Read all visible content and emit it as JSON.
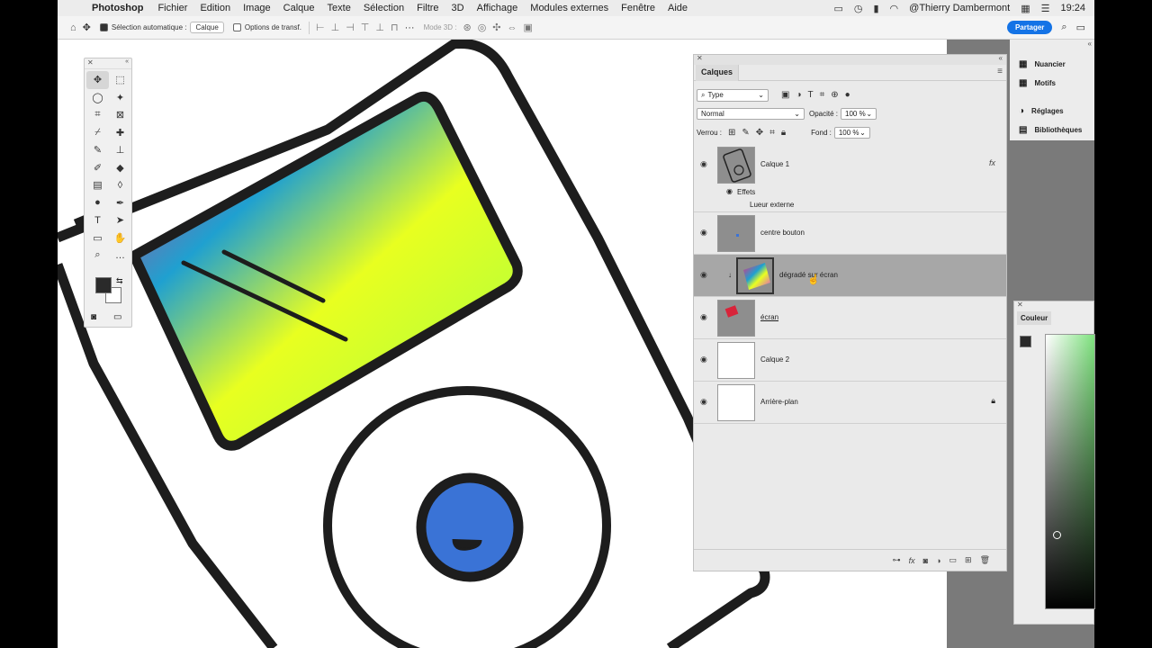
{
  "menubar": {
    "app": "Photoshop",
    "items": [
      "Fichier",
      "Edition",
      "Image",
      "Calque",
      "Texte",
      "Sélection",
      "Filtre",
      "3D",
      "Affichage",
      "Modules externes",
      "Fenêtre",
      "Aide"
    ],
    "user": "@Thierry Dambermont",
    "time": "19:24"
  },
  "optbar": {
    "auto_select_label": "Sélection automatique :",
    "auto_select_value": "Calque",
    "transform_label": "Options de transf.",
    "mode3d": "Mode 3D :",
    "share": "Partager"
  },
  "layers_panel": {
    "tab": "Calques",
    "filter": "Type",
    "blend_mode": "Normal",
    "opacity_label": "Opacité :",
    "opacity": "100 %",
    "lock_label": "Verrou :",
    "fill_label": "Fond :",
    "fill": "100 %",
    "layers": [
      {
        "name": "Calque 1",
        "fx": "fx",
        "effects_label": "Effets",
        "effect": "Lueur externe"
      },
      {
        "name": "centre bouton"
      },
      {
        "name": "dégradé sur écran"
      },
      {
        "name": "écran"
      },
      {
        "name": "Calque 2"
      },
      {
        "name": "Arrière-plan"
      }
    ]
  },
  "dock": {
    "items": [
      "Nuancier",
      "Motifs",
      "Réglages",
      "Bibliothèques"
    ]
  },
  "color_panel": {
    "tab": "Couleur"
  }
}
